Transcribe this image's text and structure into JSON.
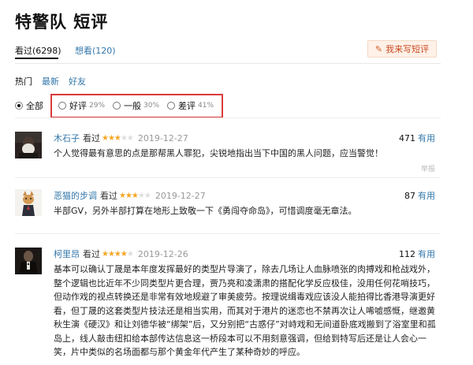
{
  "page": {
    "title": "特警队 短评"
  },
  "tabs": [
    {
      "label": "看过(6298)"
    },
    {
      "label": "想看(120)"
    }
  ],
  "write_button": {
    "label": "我来写短评",
    "icon": "pencil-icon"
  },
  "sort": [
    {
      "label": "热门"
    },
    {
      "label": "最新"
    },
    {
      "label": "好友"
    }
  ],
  "filter": {
    "all": {
      "label": "全部"
    },
    "options": [
      {
        "label": "好评",
        "percent": "29%"
      },
      {
        "label": "一般",
        "percent": "30%"
      },
      {
        "label": "差评",
        "percent": "41%"
      }
    ]
  },
  "reviews": [
    {
      "author": "木石子",
      "seen": "看过",
      "stars": "★★★",
      "stars_dim": "★★",
      "rating_of_5": 3,
      "date": "2019-12-27",
      "votes": "471",
      "useful": "有用",
      "text": "个人觉得最有意思的点是那帮黑人罪犯，尖锐地指出当下中国的黑人问题，应当警觉！",
      "report": "举报"
    },
    {
      "author": "恶猫的步调",
      "seen": "看过",
      "stars": "★★★",
      "stars_dim": "★★",
      "rating_of_5": 3,
      "date": "2019-12-27",
      "votes": "87",
      "useful": "有用",
      "text": "半部GV，另外半部打算在地形上致敬一下《勇闯夺命岛》，可惜调度毫无章法。"
    },
    {
      "author": "柯里昂",
      "seen": "看过",
      "stars": "★★★★",
      "stars_dim": "★",
      "rating_of_5": 4,
      "date": "2019-12-26",
      "votes": "112",
      "useful": "有用",
      "text": "基本可以确认丁晟是本年度发挥最好的类型片导演了，除去几场让人血脉喷张的肉搏戏和枪战戏外，整个逻辑也比近年不少同类型片更合理，贾乃亮和凌潇肃的搭配化学反应极佳，没用任何花哨技巧，但动作戏的视点转换还是非常有效地规避了审美疲劳。按理说缉毒戏应该没人能拍得比香港导演更好看，但丁晟的这套类型片技法还是相当实用，而其对于港片的迷恋也不禁再次让人唏嘘感慨，继邀黄秋生演《硬汉》和让刘德华被“绑架”后，又分别把“古惑仔”对峙戏和无间道卧底戏搬到了浴室里和孤岛上，线人敲击纽扣给本部传达信息这一桥段本可以不用刻意强调，但给到特写后还是让人会心一笑，片中类似的名场面都与那个黄金年代产生了某种奇妙的呼应。"
    }
  ]
}
